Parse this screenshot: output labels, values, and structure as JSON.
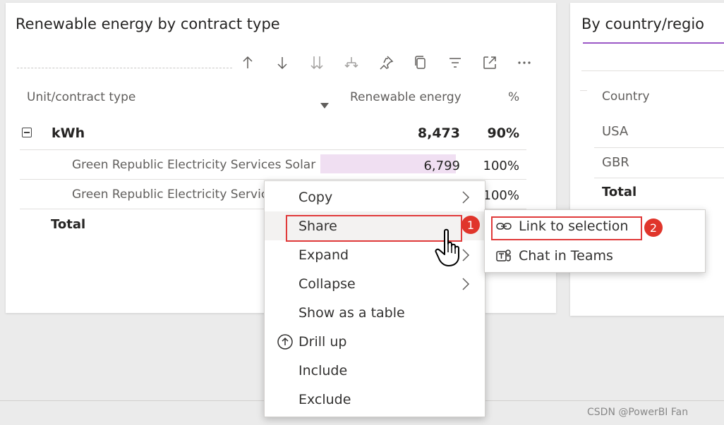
{
  "left_card": {
    "title": "Renewable energy by contract type",
    "toolbar_icons": [
      "sort-ascending-icon",
      "sort-descending-icon",
      "drill-down-all-icon",
      "expand-hierarchy-icon",
      "pin-icon",
      "copy-visual-icon",
      "filter-icon",
      "focus-mode-icon",
      "more-options-icon"
    ],
    "columns": {
      "unit": "Unit/contract type",
      "renewable": "Renewable energy",
      "percent": "%"
    },
    "rows": [
      {
        "label": "kWh",
        "value": "8,473",
        "percent": "90%"
      },
      {
        "label": "Green Republic Electricity Services Solar",
        "value": "6,799",
        "percent": "100%"
      },
      {
        "label": "Green Republic Electricity Service",
        "value": "",
        "percent": "100%"
      }
    ],
    "total_label": "Total",
    "databar_fraction": 1.0
  },
  "right_card": {
    "title": "By country/regio",
    "column": "Country",
    "rows": [
      "USA",
      "GBR"
    ],
    "total_label": "Total"
  },
  "context_menu": {
    "items": [
      {
        "label": "Copy",
        "submenu": true
      },
      {
        "label": "Share",
        "submenu": true
      },
      {
        "label": "Expand",
        "submenu": true
      },
      {
        "label": "Collapse",
        "submenu": true
      },
      {
        "label": "Show as a table",
        "submenu": false
      },
      {
        "label": "Drill up",
        "submenu": false,
        "icon": "drill-up-icon"
      },
      {
        "label": "Include",
        "submenu": false
      },
      {
        "label": "Exclude",
        "submenu": false
      }
    ]
  },
  "share_submenu": {
    "items": [
      {
        "label": "Link to selection",
        "icon": "link-icon"
      },
      {
        "label": "Chat in Teams",
        "icon": "teams-icon"
      }
    ]
  },
  "annotations": {
    "step1": "1",
    "step2": "2"
  },
  "watermark": "CSDN @PowerBI Fan",
  "colors": {
    "accent": "#9b57c6",
    "databar": "#f0dff2",
    "annotation": "#e03a3a"
  }
}
